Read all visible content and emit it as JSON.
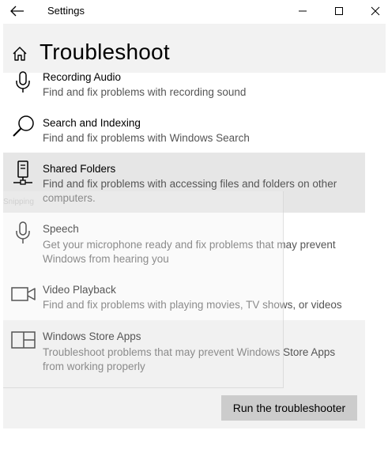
{
  "window": {
    "title": "Settings"
  },
  "header": {
    "title": "Troubleshoot"
  },
  "items": [
    {
      "name": "Recording Audio",
      "desc": "Find and fix problems with recording sound",
      "icon": "microphone-icon"
    },
    {
      "name": "Search and Indexing",
      "desc": "Find and fix problems with Windows Search",
      "icon": "search-icon"
    },
    {
      "name": "Shared Folders",
      "desc": "Find and fix problems with accessing files and folders on other computers.",
      "icon": "network-drive-icon"
    },
    {
      "name": "Speech",
      "desc": "Get your microphone ready and fix problems that may prevent Windows from hearing you",
      "icon": "microphone-icon"
    },
    {
      "name": "Video Playback",
      "desc": "Find and fix problems with playing movies, TV shows, or videos",
      "icon": "video-camera-icon"
    },
    {
      "name": "Windows Store Apps",
      "desc": "Troubleshoot problems that may prevent Windows Store Apps from working properly",
      "icon": "store-apps-icon"
    }
  ],
  "overlay": {
    "label": "Snipping"
  },
  "run_button": {
    "label": "Run the troubleshooter"
  }
}
